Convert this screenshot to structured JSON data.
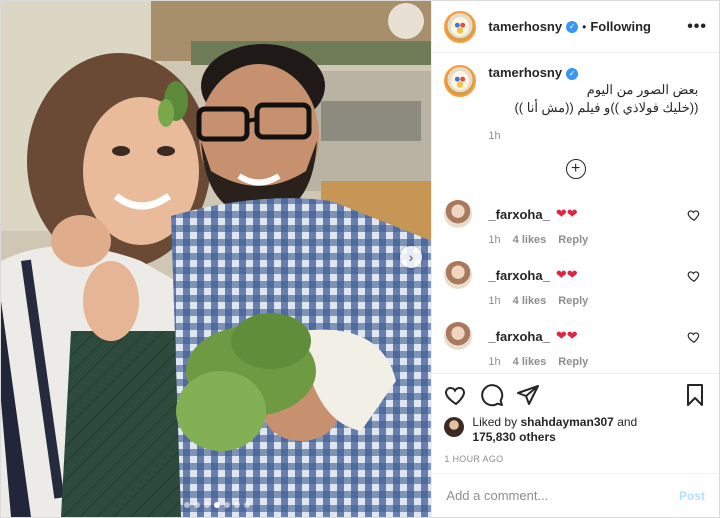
{
  "header": {
    "username": "tamerhosny",
    "separator": "•",
    "follow_status": "Following",
    "more": "•••"
  },
  "caption": {
    "username": "tamerhosny",
    "line1": "بعض الصور من اليوم",
    "line2": "((خليك فولاذي ))و فيلم ((مش أنا ))",
    "time": "1h"
  },
  "comments": [
    {
      "username": "_farxoha_",
      "emoji": "❤❤",
      "time": "1h",
      "likes": "4 likes",
      "reply": "Reply"
    },
    {
      "username": "_farxoha_",
      "emoji": "❤❤",
      "time": "1h",
      "likes": "4 likes",
      "reply": "Reply"
    },
    {
      "username": "_farxoha_",
      "emoji": "❤❤",
      "time": "1h",
      "likes": "4 likes",
      "reply": "Reply"
    }
  ],
  "likes": {
    "prefix": "Liked by",
    "user": "shahdayman307",
    "and": "and",
    "count": "175,830 others"
  },
  "post_time": "1 HOUR AGO",
  "add_comment": {
    "placeholder": "Add a comment...",
    "post_label": "Post"
  },
  "carousel": {
    "total": 7,
    "active_index": 3
  },
  "colors": {
    "verified": "#3897f0",
    "heart": "#e0243f",
    "post_disabled": "#b2dffc"
  },
  "icons": [
    "heart-icon",
    "comment-icon",
    "share-icon",
    "bookmark-icon",
    "plus-circle-icon",
    "more-icon",
    "verified-icon"
  ]
}
